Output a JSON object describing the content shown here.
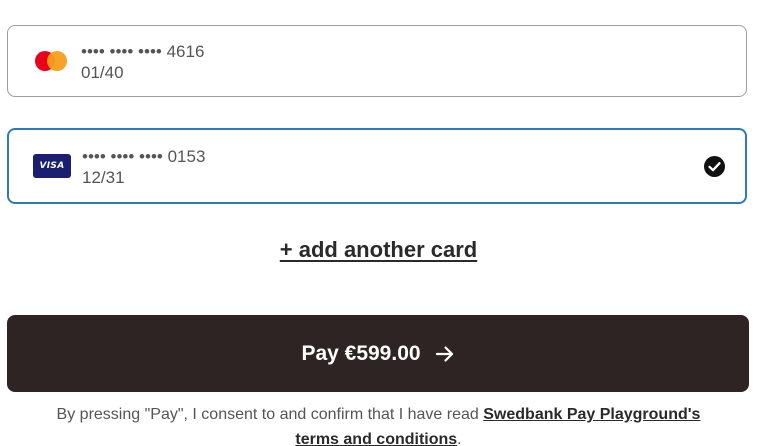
{
  "cards": [
    {
      "brand": "Mastercard",
      "brand_icon": "mastercard-logo-icon",
      "number": "•••• •••• •••• 4616",
      "expiry": "01/40",
      "selected": false
    },
    {
      "brand": "Visa",
      "brand_icon": "visa-logo-icon",
      "logo_text": "VISA",
      "number": "•••• •••• •••• 0153",
      "expiry": "12/31",
      "selected": true
    }
  ],
  "add_card_label": "+ add another card",
  "pay_button": {
    "label": "Pay €599.00",
    "icon": "arrow-right-icon"
  },
  "consent": {
    "prefix": "By pressing \"Pay\", I consent to and confirm that I have read ",
    "link_1": "Swedbank Pay Playground's",
    "link_2": "terms and conditions",
    "suffix": "."
  },
  "colors": {
    "selected_border": "#2f7bb3",
    "pay_button_bg": "#2f2424",
    "visa_blue": "#1a1f71",
    "mastercard_red": "#eb001b",
    "mastercard_orange": "#f79e1b"
  }
}
